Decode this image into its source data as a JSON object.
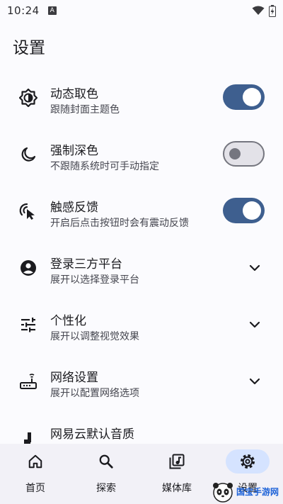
{
  "status_bar": {
    "time": "10:24",
    "notification_icon": "a-notification-icon",
    "wifi_icon": "wifi-icon",
    "battery_icon": "battery-charging-icon"
  },
  "page_title": "设置",
  "settings": [
    {
      "title": "动态取色",
      "subtitle": "跟随封面主题色",
      "icon": "brightness-auto-icon",
      "control": "toggle",
      "on": true
    },
    {
      "title": "强制深色",
      "subtitle": "不跟随系统时可手动指定",
      "icon": "moon-icon",
      "control": "toggle",
      "on": false
    },
    {
      "title": "触感反馈",
      "subtitle": "开启后点击按钮时会有震动反馈",
      "icon": "touch-feedback-icon",
      "control": "toggle",
      "on": true
    },
    {
      "title": "登录三方平台",
      "subtitle": "展开以选择登录平台",
      "icon": "account-circle-icon",
      "control": "expand"
    },
    {
      "title": "个性化",
      "subtitle": "展开以调整视觉效果",
      "icon": "tune-icon",
      "control": "expand"
    },
    {
      "title": "网络设置",
      "subtitle": "展开以配置网络选项",
      "icon": "router-icon",
      "control": "expand"
    },
    {
      "title": "网易云默认音质",
      "subtitle": "",
      "icon": "music-note-icon",
      "control": "none"
    }
  ],
  "bottom_nav": [
    {
      "label": "首页",
      "icon": "home-icon",
      "active": false
    },
    {
      "label": "探索",
      "icon": "search-icon",
      "active": false
    },
    {
      "label": "媒体库",
      "icon": "library-music-icon",
      "active": false
    },
    {
      "label": "设置",
      "icon": "settings-icon",
      "active": true
    }
  ],
  "watermark": {
    "text": "国宝手游网",
    "url_text": "www.GB315.com"
  },
  "colors": {
    "accent": "#3e5f8f",
    "active_nav": "#d5e3ff",
    "background": "#fbfbfe",
    "nav_background": "#f2f1f7"
  }
}
